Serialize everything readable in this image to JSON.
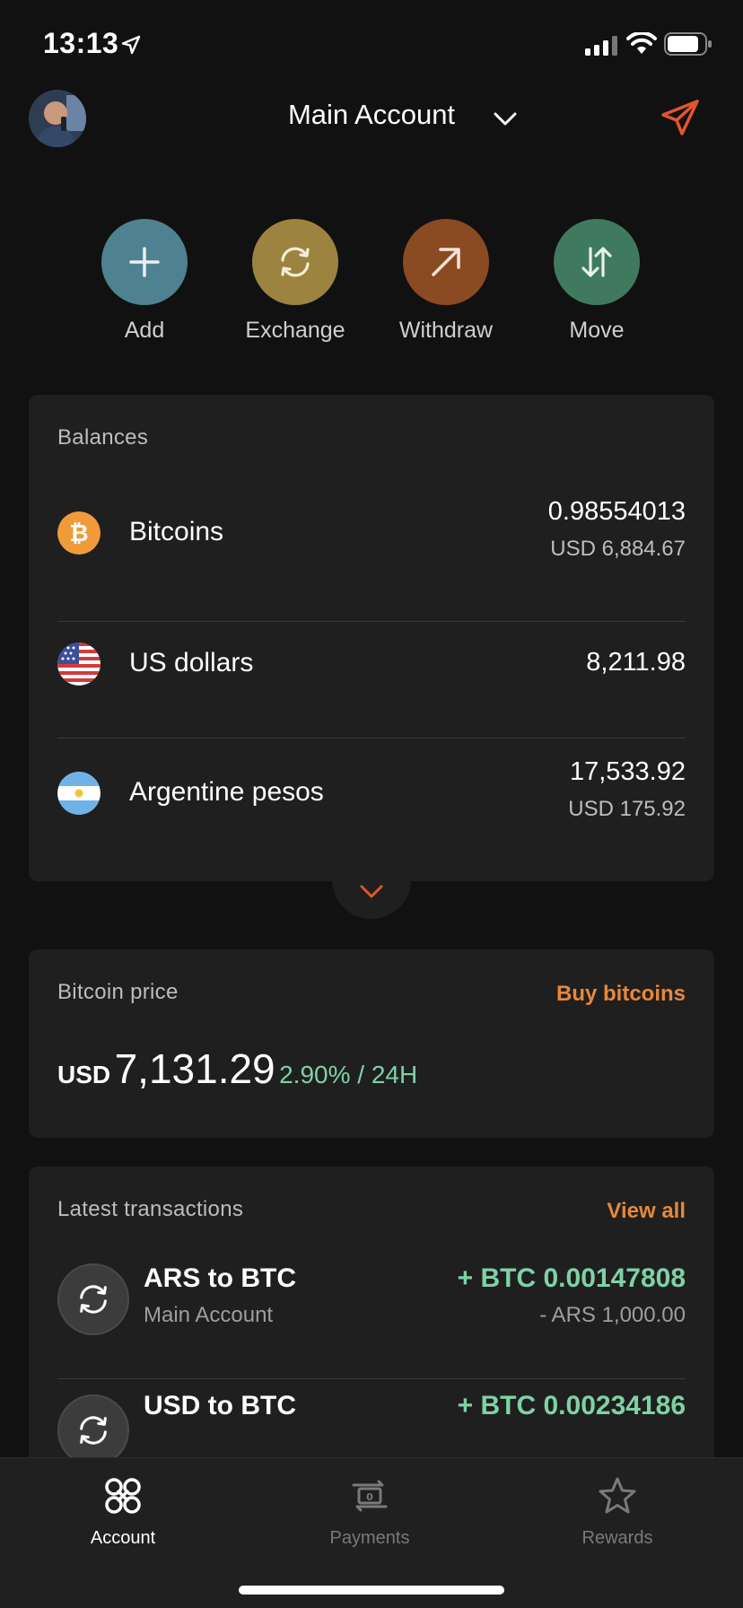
{
  "status_bar": {
    "time": "13:13"
  },
  "header": {
    "account_name": "Main Account"
  },
  "actions": [
    {
      "label": "Add",
      "color": "#4f8290"
    },
    {
      "label": "Exchange",
      "color": "#9c8440"
    },
    {
      "label": "Withdraw",
      "color": "#8a4a22"
    },
    {
      "label": "Move",
      "color": "#3f7a5e"
    }
  ],
  "balances": {
    "title": "Balances",
    "items": [
      {
        "name": "Bitcoins",
        "amount": "0.98554013",
        "sub": "USD 6,884.67",
        "icon": "bitcoin-icon"
      },
      {
        "name": "US dollars",
        "amount": "8,211.98",
        "sub": "",
        "icon": "us-flag-icon"
      },
      {
        "name": "Argentine pesos",
        "amount": "17,533.92",
        "sub": "USD 175.92",
        "icon": "argentina-flag-icon"
      }
    ]
  },
  "bitcoin_price": {
    "title": "Bitcoin price",
    "link": "Buy bitcoins",
    "currency": "USD",
    "value": "7,131.29",
    "change": "2.90% / 24H"
  },
  "transactions": {
    "title": "Latest transactions",
    "link": "View all",
    "items": [
      {
        "title": "ARS to BTC",
        "account": "Main Account",
        "amount": "+ BTC 0.00147808",
        "sub": "- ARS 1,000.00"
      },
      {
        "title": "USD to BTC",
        "account": "",
        "amount": "+ BTC 0.00234186",
        "sub": ""
      }
    ]
  },
  "tabs": [
    {
      "label": "Account",
      "active": true
    },
    {
      "label": "Payments",
      "active": false
    },
    {
      "label": "Rewards",
      "active": false
    }
  ],
  "colors": {
    "accent": "#e8873a",
    "positive": "#7fd1a6",
    "background": "#111111",
    "card": "#1f1f1f"
  }
}
